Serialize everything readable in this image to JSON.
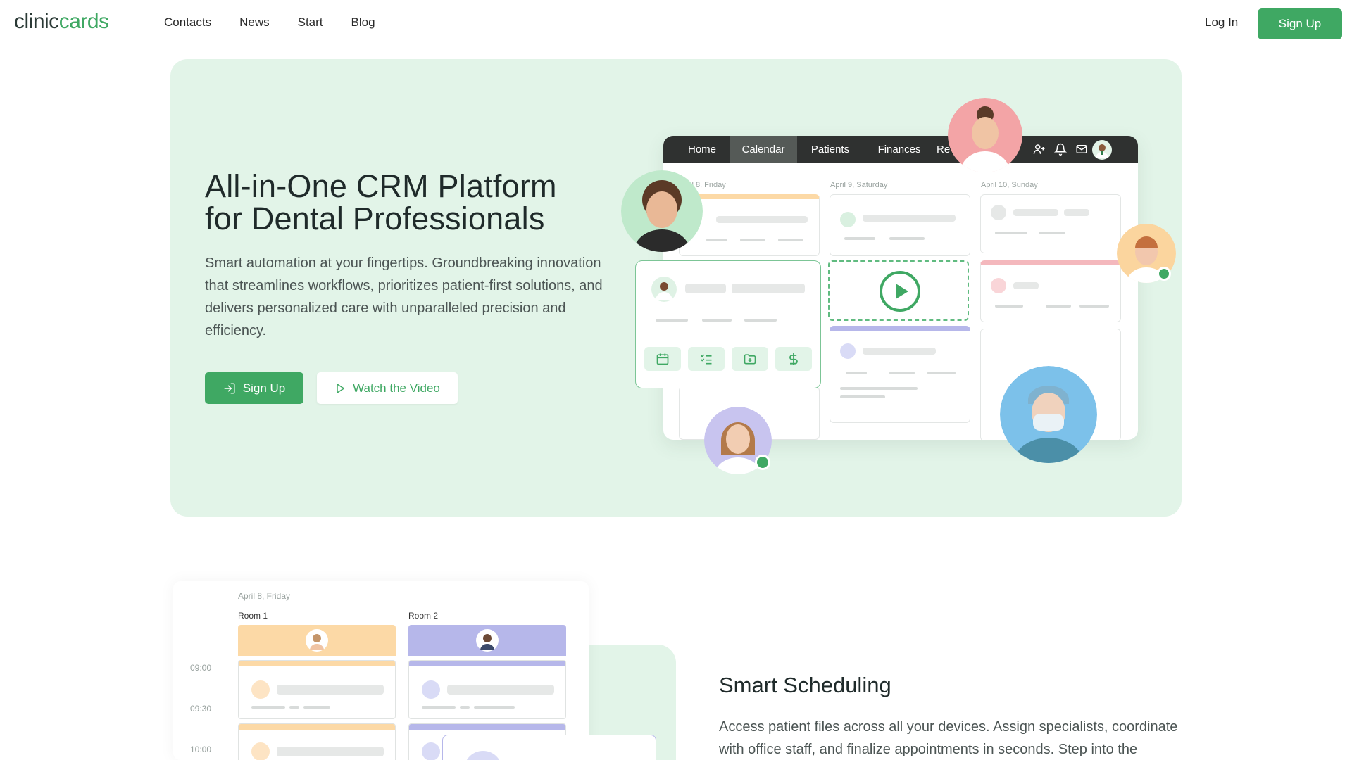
{
  "brand": {
    "part1": "clinic",
    "part2": "cards"
  },
  "nav": [
    "Contacts",
    "News",
    "Start",
    "Blog"
  ],
  "auth": {
    "login": "Log In",
    "signup": "Sign Up"
  },
  "hero": {
    "title_line1": "All-in-One CRM Platform",
    "title_line2": "for Dental Professionals",
    "description": "Smart automation at your fingertips. Groundbreaking innovation that streamlines workflows, prioritizes patient-first solutions, and delivers personalized care with unparalleled precision and efficiency.",
    "signup_button": "Sign Up",
    "video_button": "Watch the Video",
    "signup_icon": "login-icon",
    "video_icon": "play-icon"
  },
  "mockup": {
    "tabs": [
      "Home",
      "Calendar",
      "Patients",
      "Finances",
      "Re"
    ],
    "active_tab": "Calendar",
    "icons": [
      "users-icon",
      "bell-icon",
      "mail-icon",
      "avatar"
    ],
    "days": [
      "il 8, Friday",
      "April 9, Saturday",
      "April 10, Sunday"
    ],
    "card_actions": [
      "calendar-icon",
      "checklist-icon",
      "folder-add-icon",
      "dollar-icon"
    ]
  },
  "schedule": {
    "date": "April 8, Friday",
    "rooms": [
      "Room 1",
      "Room 2"
    ],
    "times": [
      "09:00",
      "09:30",
      "10:00"
    ]
  },
  "feature": {
    "title": "Smart Scheduling",
    "description": "Access patient files across all your devices. Assign specialists, coordinate with office staff, and finalize appointments in seconds. Step into the"
  },
  "colors": {
    "brand_green": "#3fa863",
    "hero_bg": "#e2f4e8",
    "dark_bar": "#2f3130",
    "orange_accent": "#fcd9a6",
    "purple_accent": "#b6b7ea",
    "pink_accent": "#f4b8bd"
  }
}
